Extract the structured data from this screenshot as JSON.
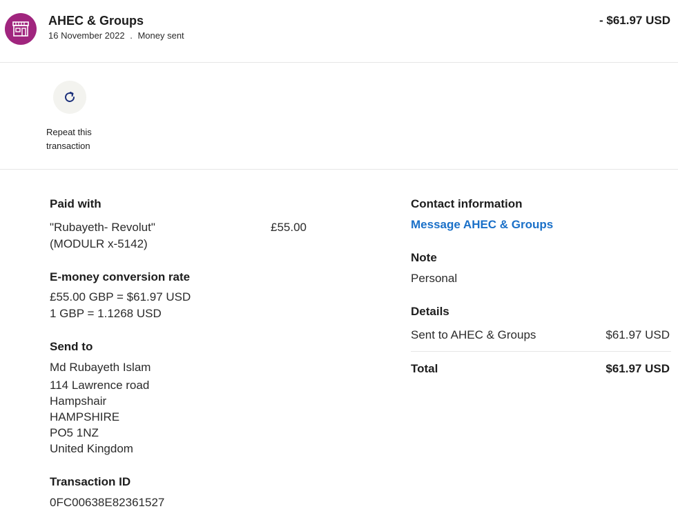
{
  "header": {
    "merchant": "AHEC & Groups",
    "date": "16 November 2022",
    "separator": ".",
    "type": "Money sent",
    "amount": "- $61.97 USD",
    "avatar_color": "#a0257e",
    "avatar_icon": "storefront-icon"
  },
  "actions": {
    "repeat_line1": "Repeat this",
    "repeat_line2": "transaction",
    "repeat_icon": "refresh-icon"
  },
  "paid_with": {
    "heading": "Paid with",
    "source_line1": "\"Rubayeth- Revolut\"",
    "source_line2": "(MODULR x-5142)",
    "amount": "£55.00"
  },
  "conversion": {
    "heading": "E-money conversion rate",
    "line1": "£55.00 GBP = $61.97 USD",
    "line2": "1 GBP = 1.1268 USD"
  },
  "send_to": {
    "heading": "Send to",
    "lines": [
      "Md Rubayeth Islam",
      "114 Lawrence road",
      "Hampshair",
      "HAMPSHIRE",
      "PO5 1NZ",
      "United Kingdom"
    ]
  },
  "transaction": {
    "heading": "Transaction ID",
    "id": "0FC00638E82361527"
  },
  "contact": {
    "heading": "Contact information",
    "link": "Message AHEC & Groups",
    "link_color": "#1a70c8"
  },
  "note": {
    "heading": "Note",
    "value": "Personal"
  },
  "details": {
    "heading": "Details",
    "row_label": "Sent to AHEC & Groups",
    "row_value": "$61.97 USD",
    "total_label": "Total",
    "total_value": "$61.97 USD"
  }
}
